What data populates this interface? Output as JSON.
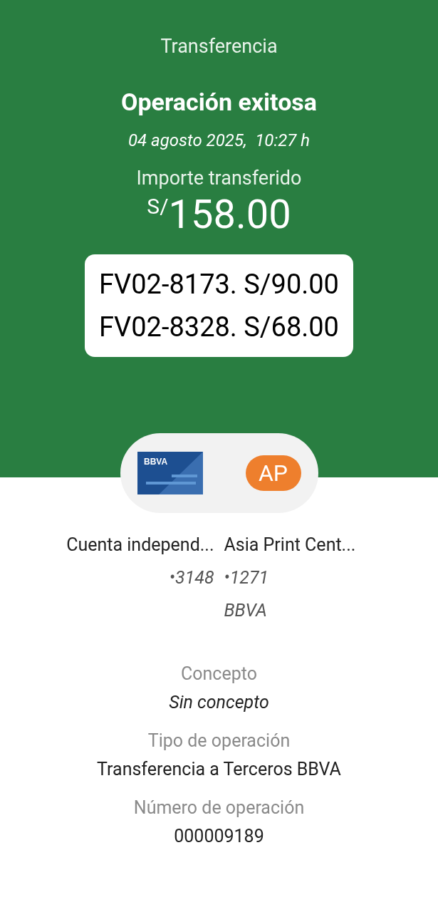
{
  "header": {
    "title": "Transferencia",
    "status": "Operación exitosa",
    "datetime": "04 agosto 2025,  10:27 h",
    "amount_label": "Importe transferido",
    "currency": "S/",
    "amount": "158.00"
  },
  "note_lines": [
    "FV02-8173. S/90.00",
    "FV02-8328. S/68.00"
  ],
  "source": {
    "card_label": "BBVA",
    "name": "Cuenta independ...",
    "account": "•3148"
  },
  "destination": {
    "initials": "AP",
    "name": "Asia Print Cent...",
    "account": "•1271",
    "bank": "BBVA"
  },
  "details": [
    {
      "label": "Concepto",
      "value": "Sin concepto",
      "kind": "italic"
    },
    {
      "label": "Tipo de operación",
      "value": "Transferencia a Terceros BBVA",
      "kind": "plain"
    },
    {
      "label": "Número de operación",
      "value": "000009189",
      "kind": "plain"
    }
  ]
}
